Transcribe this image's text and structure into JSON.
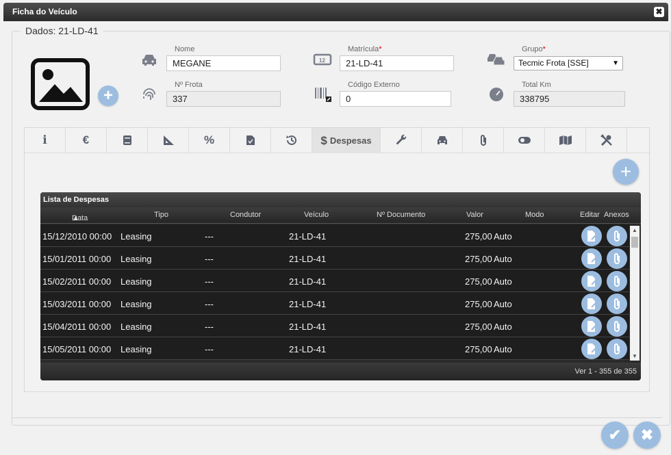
{
  "window": {
    "title": "Ficha do Veículo",
    "close_label": "✖"
  },
  "section": {
    "legend": "Dados: 21-LD-41"
  },
  "fields": {
    "nome": {
      "label": "Nome",
      "value": "MEGANE"
    },
    "matricula": {
      "label": "Matrícula",
      "required": "*",
      "value": "21-LD-41"
    },
    "grupo": {
      "label": "Grupo",
      "required": "*",
      "value": "Tecmic Frota [SSE]"
    },
    "frota": {
      "label": "Nº Frota",
      "value": "337"
    },
    "codigo": {
      "label": "Código Externo",
      "value": "0"
    },
    "km": {
      "label": "Total Km",
      "value": "338795"
    }
  },
  "tabs": {
    "active_label": "Despesas",
    "icons": [
      "info-icon",
      "euro-icon",
      "book-icon",
      "ruler-icon",
      "percent-icon",
      "document-icon",
      "history-icon",
      "dollar-icon",
      "wrench-icon",
      "car-front-icon",
      "paperclip-icon",
      "toggle-icon",
      "map-icon",
      "tools-icon"
    ]
  },
  "grid": {
    "title": "Lista de Despesas",
    "columns": {
      "data": "Data",
      "tipo": "Tipo",
      "condutor": "Condutor",
      "veiculo": "Veículo",
      "documento": "Nº Documento",
      "valor": "Valor",
      "modo": "Modo",
      "editar": "Editar",
      "anexos": "Anexos"
    },
    "rows": [
      {
        "data": "15/12/2010 00:00",
        "tipo": "Leasing",
        "condutor": "---",
        "veiculo": "21-LD-41",
        "valor": "275,00",
        "modo": "Auto"
      },
      {
        "data": "15/01/2011 00:00",
        "tipo": "Leasing",
        "condutor": "---",
        "veiculo": "21-LD-41",
        "valor": "275,00",
        "modo": "Auto"
      },
      {
        "data": "15/02/2011 00:00",
        "tipo": "Leasing",
        "condutor": "---",
        "veiculo": "21-LD-41",
        "valor": "275,00",
        "modo": "Auto"
      },
      {
        "data": "15/03/2011 00:00",
        "tipo": "Leasing",
        "condutor": "---",
        "veiculo": "21-LD-41",
        "valor": "275,00",
        "modo": "Auto"
      },
      {
        "data": "15/04/2011 00:00",
        "tipo": "Leasing",
        "condutor": "---",
        "veiculo": "21-LD-41",
        "valor": "275,00",
        "modo": "Auto"
      },
      {
        "data": "15/05/2011 00:00",
        "tipo": "Leasing",
        "condutor": "---",
        "veiculo": "21-LD-41",
        "valor": "275,00",
        "modo": "Auto"
      }
    ],
    "footer": "Ver 1 - 355 de 355"
  },
  "colors": {
    "accent": "#9cbde0",
    "header": "#2b2b2b",
    "row_bg": "#1e1e1e"
  }
}
